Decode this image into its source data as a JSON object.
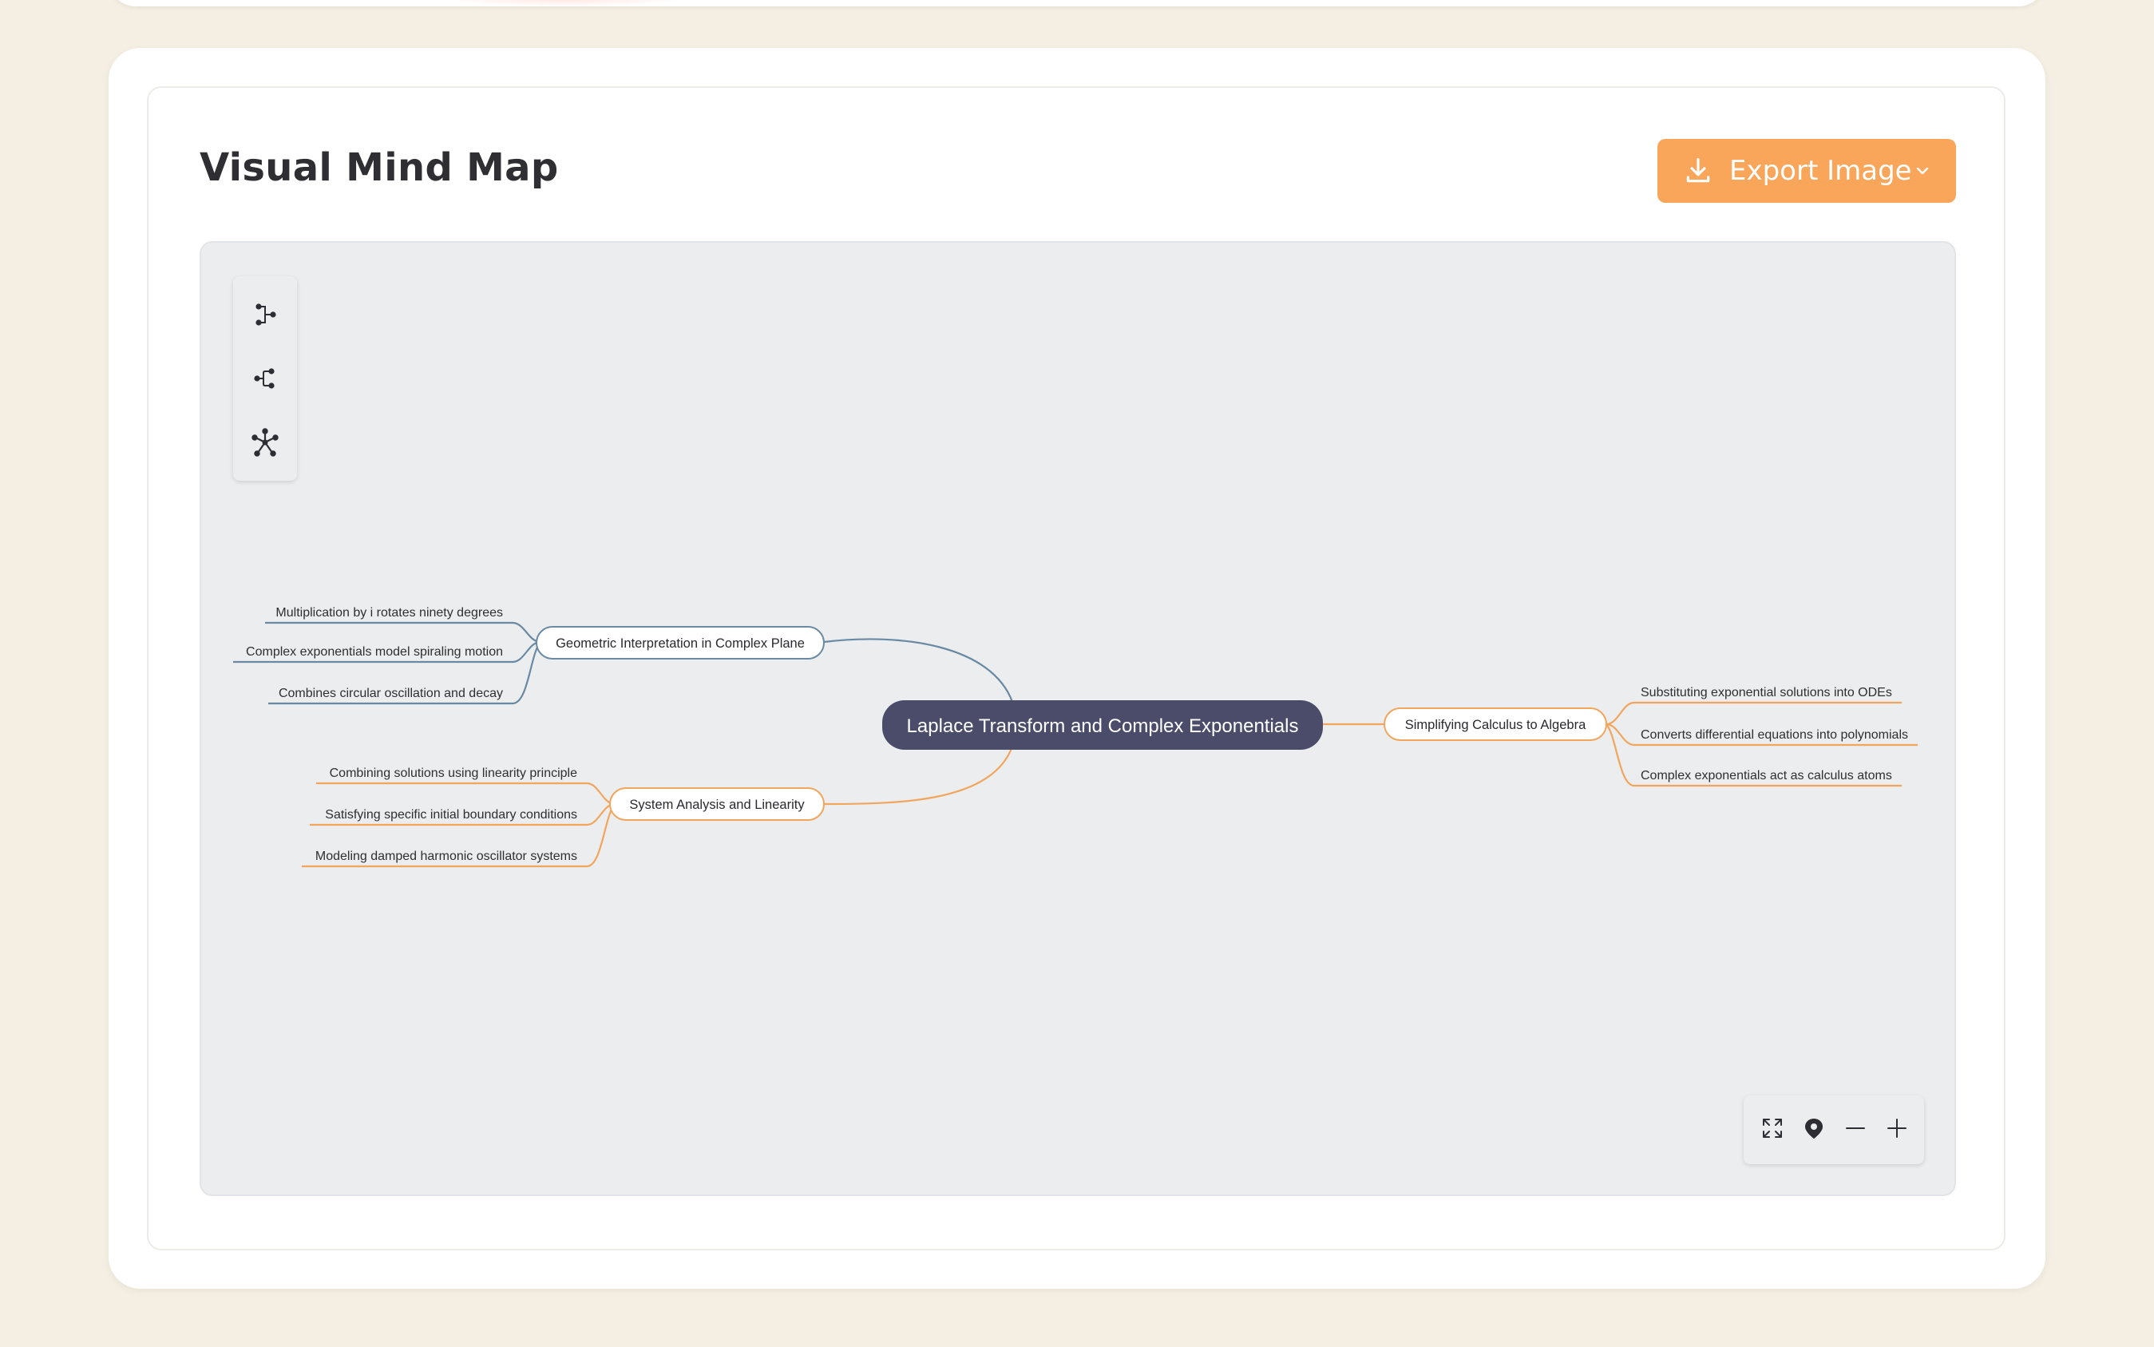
{
  "header": {
    "title": "Visual Mind Map",
    "export_label": "Export Image"
  },
  "toolbar": {
    "layout_tools": [
      "layout-right-icon",
      "layout-left-icon",
      "layout-radial-icon"
    ],
    "zoom_tools": [
      "fit-screen-icon",
      "locate-center-icon",
      "zoom-out-icon",
      "zoom-in-icon"
    ]
  },
  "colors": {
    "page_background": "#f4efe2",
    "accent_orange": "#f9a55a",
    "root_fill": "#4a4c6a",
    "branch_blue": "#6a8aa4",
    "branch_orange": "#f2a55c",
    "canvas": "#ebedef"
  },
  "mindmap": {
    "root": "Laplace Transform and Complex Exponentials",
    "branches": [
      {
        "label": "Geometric Interpretation in Complex Plane",
        "children": [
          "Multiplication by i rotates ninety degrees",
          "Complex exponentials model spiraling motion",
          "Combines circular oscillation and decay"
        ]
      },
      {
        "label": "System Analysis and Linearity",
        "children": [
          "Combining solutions using linearity principle",
          "Satisfying specific initial boundary conditions",
          "Modeling damped harmonic oscillator systems"
        ]
      },
      {
        "label": "Simplifying Calculus to Algebra",
        "children": [
          "Substituting exponential solutions into ODEs",
          "Converts differential equations into polynomials",
          "Complex exponentials act as calculus atoms"
        ]
      }
    ]
  }
}
